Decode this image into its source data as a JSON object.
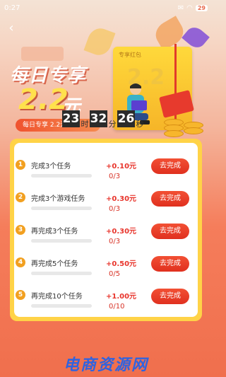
{
  "status_bar": {
    "time": "0:27",
    "battery": "29"
  },
  "header": {
    "title": "每日专享",
    "amount": "2.2",
    "amount_unit": "元",
    "sub_banner": "每日专享 2.2元",
    "countdown": {
      "hours": "23",
      "hours_unit": "时",
      "minutes": "32",
      "minutes_unit": "分",
      "seconds": "26",
      "seconds_unit": "秒"
    },
    "envelope": {
      "label": "专享红包",
      "value": "2.2"
    }
  },
  "tasks": [
    {
      "num": "1",
      "name": "完成3个任务",
      "reward": "+0.10元",
      "progress": "0/3",
      "progress_fraction": 0,
      "button": "去完成"
    },
    {
      "num": "2",
      "name": "完成3个游戏任务",
      "reward": "+0.30元",
      "progress": "0/3",
      "progress_fraction": 0,
      "button": "去完成"
    },
    {
      "num": "3",
      "name": "再完成3个任务",
      "reward": "+0.30元",
      "progress": "0/3",
      "progress_fraction": 0,
      "button": "去完成"
    },
    {
      "num": "4",
      "name": "再完成5个任务",
      "reward": "+0.50元",
      "progress": "0/5",
      "progress_fraction": 0,
      "button": "去完成"
    },
    {
      "num": "5",
      "name": "再完成10个任务",
      "reward": "+1.00元",
      "progress": "0/10",
      "progress_fraction": 0,
      "button": "去完成"
    }
  ],
  "watermark": "电商资源网",
  "colors": {
    "accent": "#e8342b",
    "button": "#f25034",
    "card_border": "#ffd347",
    "number_badge": "#f2a020"
  }
}
